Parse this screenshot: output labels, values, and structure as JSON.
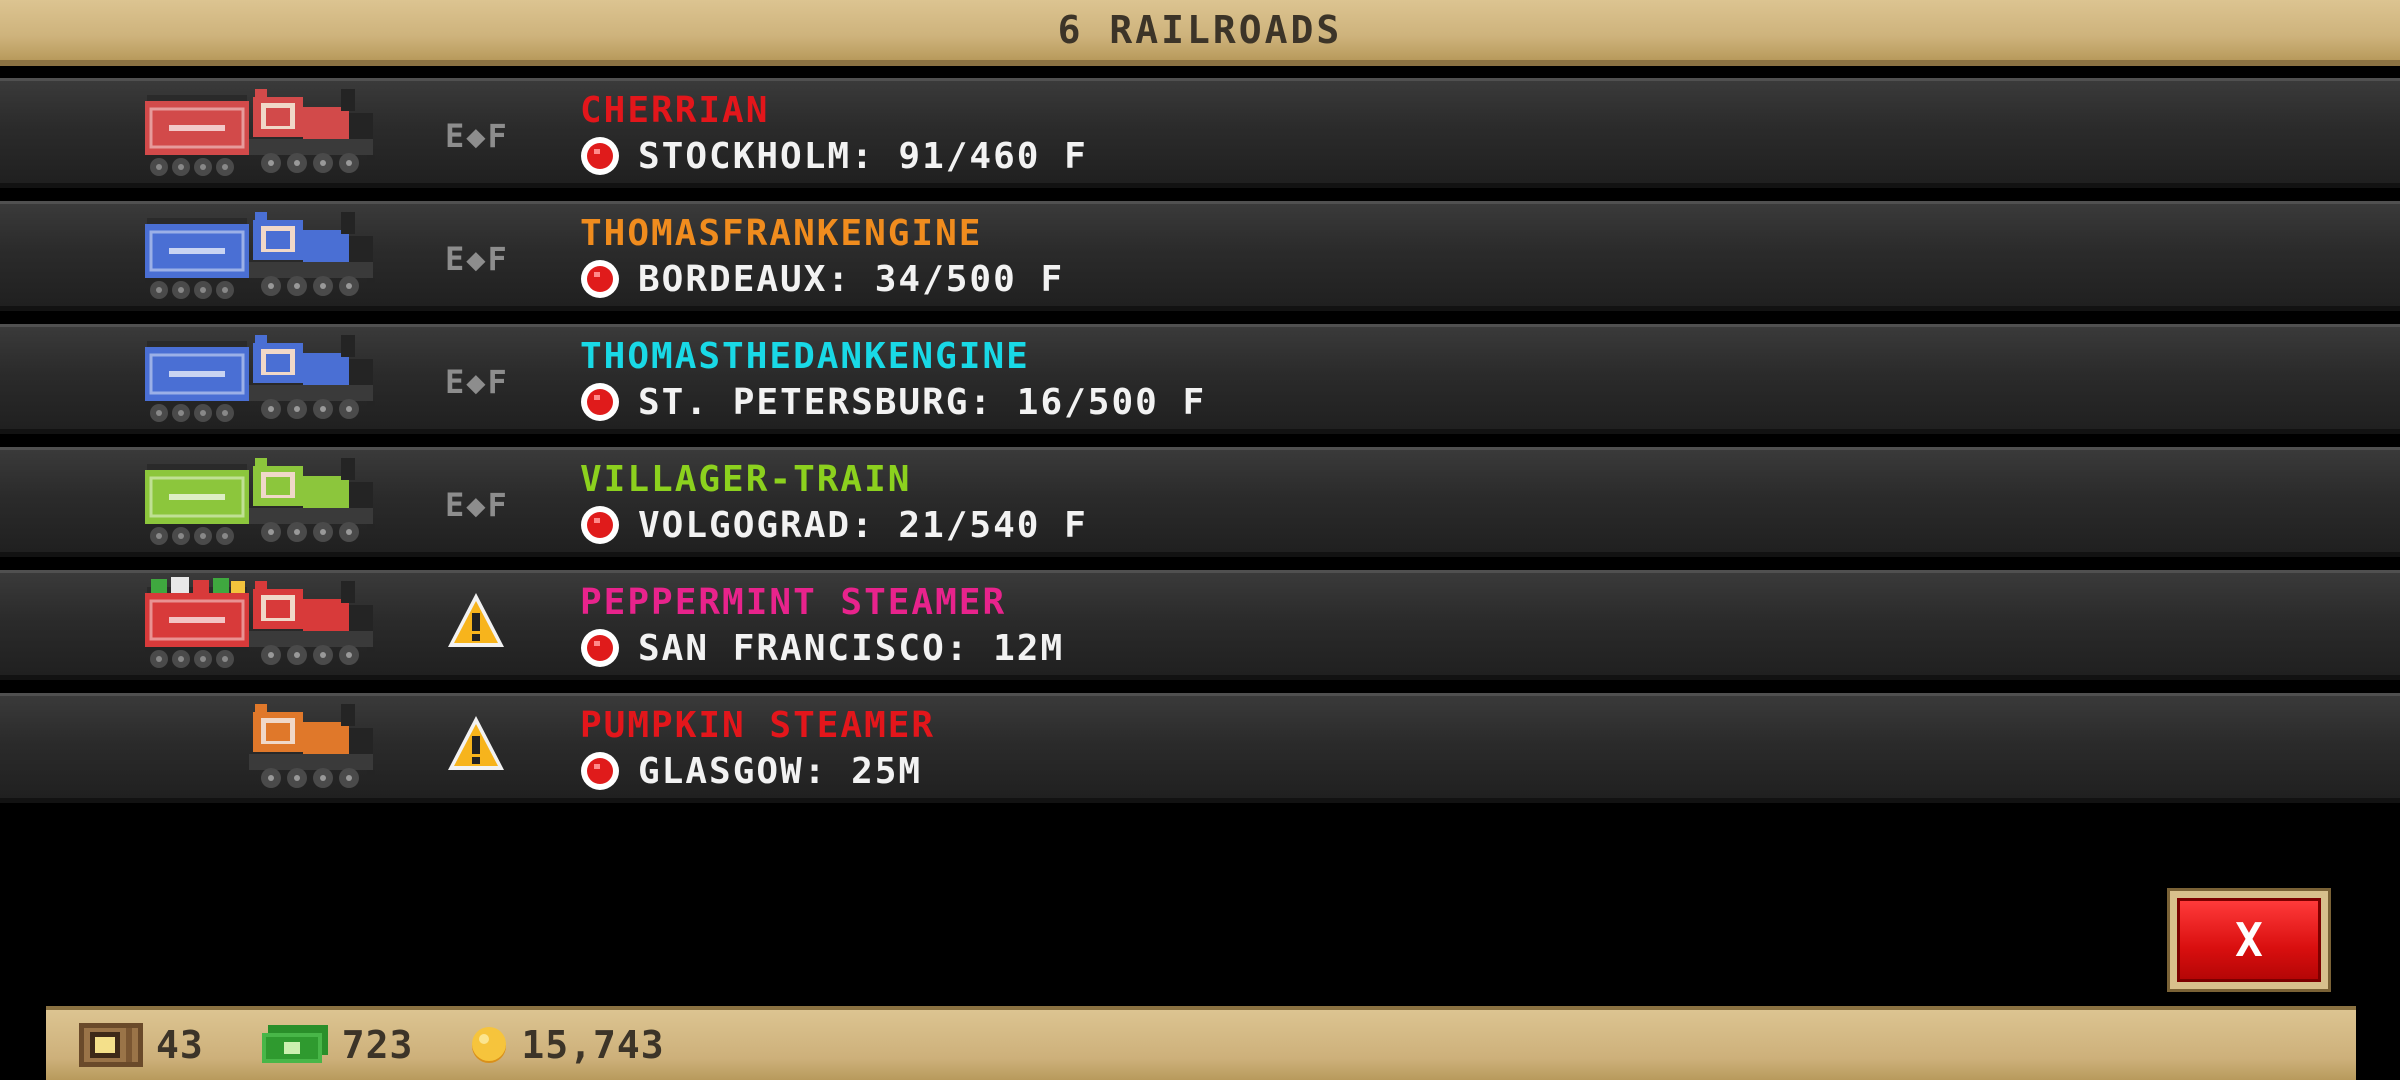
{
  "header": {
    "title": "6 RAILROADS"
  },
  "rows": [
    {
      "name": "CHERRIAN",
      "name_color": "#e3161b",
      "destination": "STOCKHOLM: 91/460 F",
      "status": "E◆F",
      "warning": false,
      "train_color": "#d24a4a",
      "tender": true,
      "gifts": false
    },
    {
      "name": "THOMASFRANKENGINE",
      "name_color": "#f08c1e",
      "destination": "BORDEAUX: 34/500 F",
      "status": "E◆F",
      "warning": false,
      "train_color": "#4a6fd4",
      "tender": true,
      "gifts": false
    },
    {
      "name": "THOMASTHEDANKENGINE",
      "name_color": "#19d9e6",
      "destination": "ST. PETERSBURG: 16/500 F",
      "status": "E◆F",
      "warning": false,
      "train_color": "#4a6fd4",
      "tender": true,
      "gifts": false
    },
    {
      "name": "VILLAGER-TRAIN",
      "name_color": "#8cd11e",
      "destination": "VOLGOGRAD: 21/540 F",
      "status": "E◆F",
      "warning": false,
      "train_color": "#8cc63c",
      "tender": true,
      "gifts": false
    },
    {
      "name": "PEPPERMINT STEAMER",
      "name_color": "#e8238c",
      "destination": "SAN FRANCISCO: 12M",
      "status": "",
      "warning": true,
      "train_color": "#d83a3a",
      "tender": true,
      "gifts": true
    },
    {
      "name": "PUMPKIN STEAMER",
      "name_color": "#e3161b",
      "destination": "GLASGOW: 25M",
      "status": "",
      "warning": true,
      "train_color": "#e0782a",
      "tender": false,
      "gifts": false
    }
  ],
  "close_button": {
    "label": "X"
  },
  "footer": {
    "box_count": "43",
    "cash": "723",
    "coins": "15,743"
  }
}
